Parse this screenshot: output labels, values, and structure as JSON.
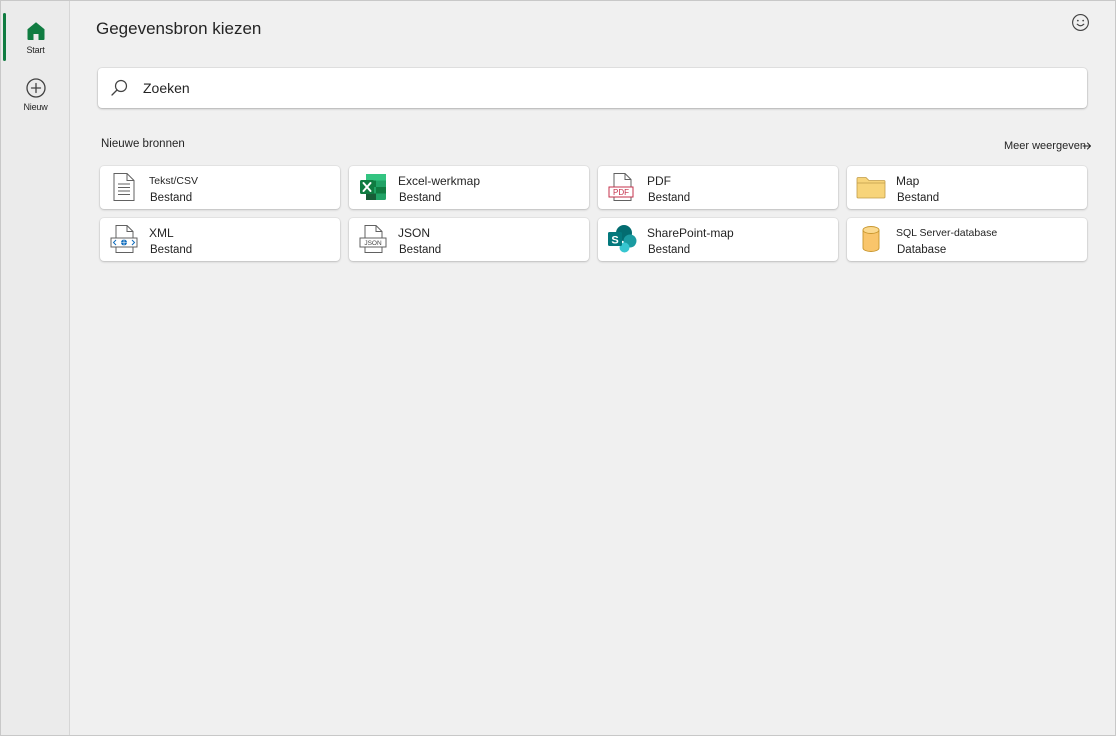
{
  "rail": {
    "items": [
      {
        "label": "Start",
        "icon": "home-icon"
      },
      {
        "label": "Nieuw",
        "icon": "add-circle-icon"
      }
    ]
  },
  "header": {
    "title": "Gegevensbron kiezen",
    "feedback_icon": "smiley-icon"
  },
  "search": {
    "placeholder": "Zoeken",
    "value": ""
  },
  "section": {
    "title": "Nieuwe bronnen",
    "more_label": "Meer weergeven"
  },
  "sources": [
    {
      "name": "Tekst/CSV",
      "type": "Bestand",
      "icon": "text-file-icon"
    },
    {
      "name": "Excel-werkmap",
      "type": "Bestand",
      "icon": "excel-icon"
    },
    {
      "name": "PDF",
      "type": "Bestand",
      "icon": "pdf-icon"
    },
    {
      "name": "Map",
      "type": "Bestand",
      "icon": "folder-icon"
    },
    {
      "name": "XML",
      "type": "Bestand",
      "icon": "xml-file-icon"
    },
    {
      "name": "JSON",
      "type": "Bestand",
      "icon": "json-file-icon"
    },
    {
      "name": "SharePoint-map",
      "type": "Bestand",
      "icon": "sharepoint-icon"
    },
    {
      "name": "SQL Server-database",
      "type": "Database",
      "icon": "database-icon"
    }
  ],
  "colors": {
    "accent": "#107c41",
    "excel": "#107c41",
    "sharepoint": "#038387",
    "folder": "#f7d47a",
    "database": "#f9c56b",
    "pdf": "#c4314b"
  }
}
